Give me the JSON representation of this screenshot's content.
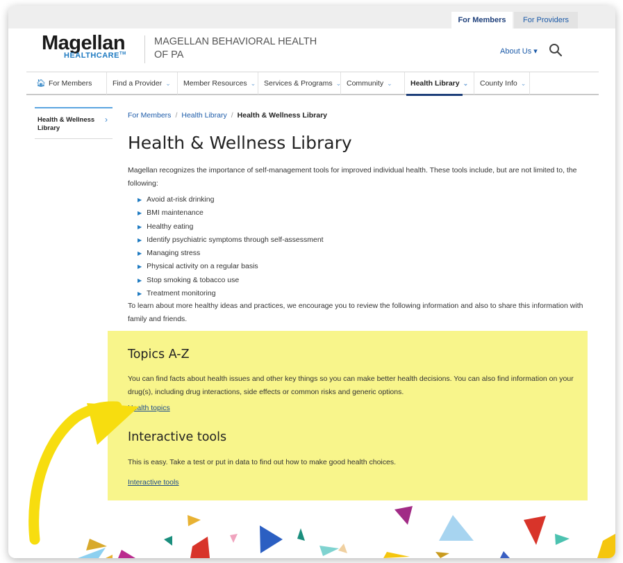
{
  "top_tabs": [
    "For Members",
    "For Providers"
  ],
  "logo": {
    "main": "Magellan",
    "sub": "HEALTHCARE",
    "tm": "TM"
  },
  "org_name": "MAGELLAN BEHAVIORAL HEALTH OF PA",
  "about_us": "About Us ▾",
  "nav": [
    {
      "label": "For Members"
    },
    {
      "label": "Find a Provider"
    },
    {
      "label": "Member Resources"
    },
    {
      "label": "Services & Programs"
    },
    {
      "label": "Community"
    },
    {
      "label": "Health Library"
    },
    {
      "label": "County Info"
    }
  ],
  "sidebar": {
    "label": "Health & Wellness Library"
  },
  "breadcrumb": [
    "For Members",
    "Health Library",
    "Health & Wellness Library"
  ],
  "page_title": "Health & Wellness Library",
  "intro": "Magellan recognizes the importance of self-management tools for improved individual health. These tools include, but are not limited to, the following:",
  "bullets": [
    "Avoid at-risk drinking",
    "BMI maintenance",
    "Healthy eating",
    "Identify psychiatric symptoms through self-assessment",
    "Managing stress",
    "Physical activity on a regular basis",
    "Stop smoking & tobacco use",
    "Treatment monitoring"
  ],
  "outro": "To learn about more healthy ideas and practices, we encourage you to review the following information and also to share this information with family and friends.",
  "topics": {
    "heading": "Topics A-Z",
    "text": "You can find facts about health issues and other key things so you can make better health decisions. You can also find information on your drug(s), including drug interactions, side effects or common risks and generic options.",
    "link": "Health topics"
  },
  "tools": {
    "heading": "Interactive tools",
    "text": "This is easy. Take a test or put in data to find out how to make good health choices.",
    "link": "Interactive tools"
  },
  "colors": {
    "highlight": "#f8f58b",
    "arrow": "#f7dd0f",
    "link": "#1b5aa8",
    "brand_blue": "#1e7ac1"
  }
}
